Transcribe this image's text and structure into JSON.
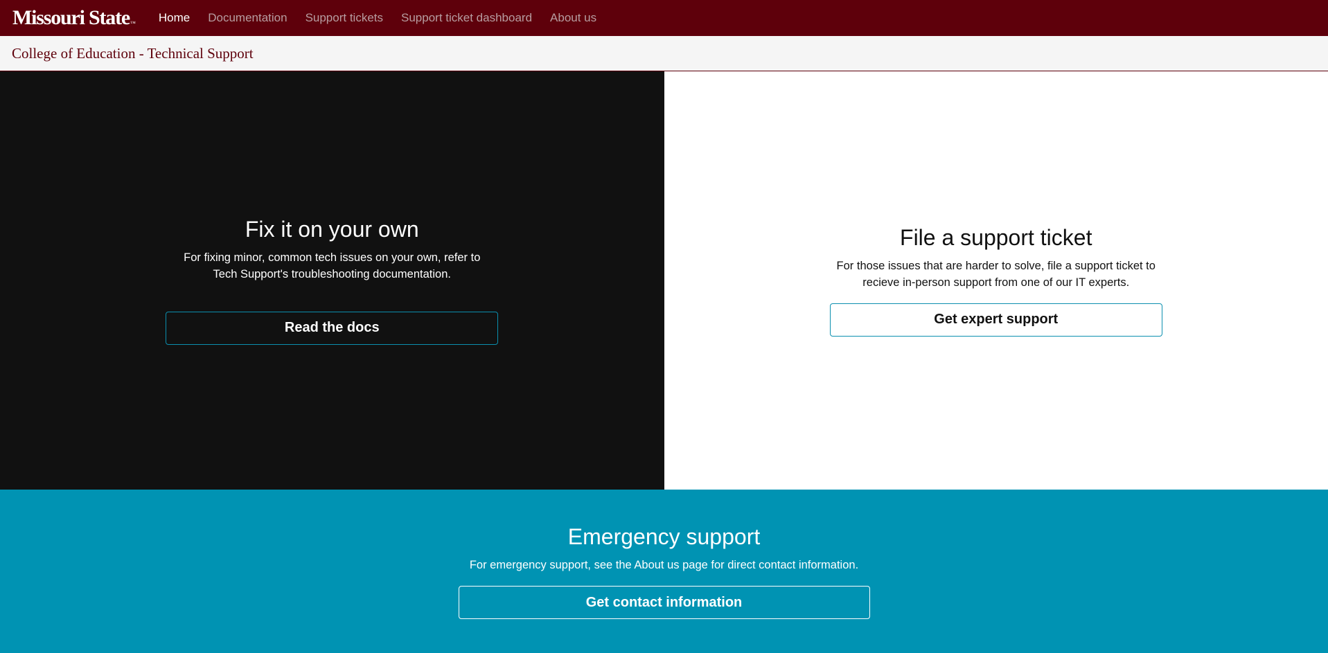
{
  "brand": {
    "name": "Missouri State",
    "trademark": "™"
  },
  "nav": {
    "items": [
      {
        "label": "Home",
        "active": true
      },
      {
        "label": "Documentation",
        "active": false
      },
      {
        "label": "Support tickets",
        "active": false
      },
      {
        "label": "Support ticket dashboard",
        "active": false
      },
      {
        "label": "About us",
        "active": false
      }
    ]
  },
  "subheader": {
    "title": "College of Education - Technical Support"
  },
  "self_help": {
    "heading": "Fix it on your own",
    "description": "For fixing minor, common tech issues on your own, refer to Tech Support's troubleshooting documentation.",
    "button_label": "Read the docs"
  },
  "ticket": {
    "heading": "File a support ticket",
    "description": "For those issues that are harder to solve, file a support ticket to recieve in-person support from one of our IT experts.",
    "button_label": "Get expert support"
  },
  "emergency": {
    "heading": "Emergency support",
    "description": "For emergency support, see the About us page for direct contact information.",
    "button_label": "Get contact information"
  },
  "colors": {
    "brand_maroon": "#5e000b",
    "accent_teal": "#0093b3",
    "dark_panel": "#111111",
    "nav_inactive": "#b79da1"
  }
}
